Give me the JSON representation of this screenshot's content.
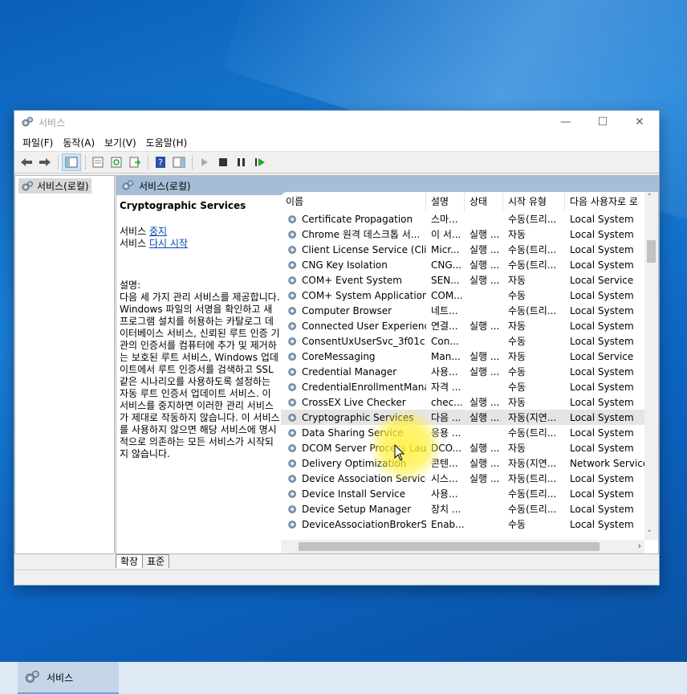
{
  "window": {
    "title": "서비스",
    "controls": [
      "minimize-icon",
      "maximize-icon",
      "close-icon"
    ]
  },
  "menu": [
    "파일(F)",
    "동작(A)",
    "보기(V)",
    "도움말(H)"
  ],
  "tree": {
    "root_label": "서비스(로컬)"
  },
  "pane": {
    "header_label": "서비스(로컬)"
  },
  "detail": {
    "service_name": "Cryptographic Services",
    "stop_prefix": "서비스 ",
    "stop_link": "중지",
    "restart_prefix": "서비스 ",
    "restart_link": "다시 시작",
    "desc_label": "설명:",
    "desc_text": "다음 세 가지 관리 서비스를 제공합니다. Windows 파일의 서명을 확인하고 새 프로그램 설치를 허용하는 카탈로그 데이터베이스 서비스, 신뢰된 루트 인증 기관의 인증서를 컴퓨터에 추가 및 제거하는 보호된 루트 서비스, Windows 업데이트에서 루트 인증서를 검색하고 SSL 같은 시나리오를 사용하도록 설정하는 자동 루트 인증서 업데이트 서비스. 이 서비스를 중지하면 이러한 관리 서비스가 제대로 작동하지 않습니다. 이 서비스를 사용하지 않으면 해당 서비스에 명시적으로 의존하는 모든 서비스가 시작되지 않습니다."
  },
  "columns": [
    "이름",
    "설명",
    "상태",
    "시작 유형",
    "다음 사용자로 로"
  ],
  "services": [
    {
      "name": "Certificate Propagation",
      "desc": "스마...",
      "status": "",
      "startup": "수동(트리...",
      "logon": "Local System"
    },
    {
      "name": "Chrome 원격 데스크톱 서...",
      "desc": "이 서...",
      "status": "실행 ...",
      "startup": "자동",
      "logon": "Local System"
    },
    {
      "name": "Client License Service (Clip...",
      "desc": "Micr...",
      "status": "실행 ...",
      "startup": "수동(트리...",
      "logon": "Local System"
    },
    {
      "name": "CNG Key Isolation",
      "desc": "CNG...",
      "status": "실행 ...",
      "startup": "수동(트리...",
      "logon": "Local System"
    },
    {
      "name": "COM+ Event System",
      "desc": "SEN...",
      "status": "실행 ...",
      "startup": "자동",
      "logon": "Local Service"
    },
    {
      "name": "COM+ System Application",
      "desc": "COM...",
      "status": "",
      "startup": "수동",
      "logon": "Local System"
    },
    {
      "name": "Computer Browser",
      "desc": "네트...",
      "status": "",
      "startup": "수동(트리...",
      "logon": "Local System"
    },
    {
      "name": "Connected User Experience...",
      "desc": "연결...",
      "status": "실행 ...",
      "startup": "자동",
      "logon": "Local System"
    },
    {
      "name": "ConsentUxUserSvc_3f01c",
      "desc": "Con...",
      "status": "",
      "startup": "수동",
      "logon": "Local System"
    },
    {
      "name": "CoreMessaging",
      "desc": "Man...",
      "status": "실행 ...",
      "startup": "자동",
      "logon": "Local Service"
    },
    {
      "name": "Credential Manager",
      "desc": "사용...",
      "status": "실행 ...",
      "startup": "수동",
      "logon": "Local System"
    },
    {
      "name": "CredentialEnrollmentMana...",
      "desc": "자격 ...",
      "status": "",
      "startup": "수동",
      "logon": "Local System"
    },
    {
      "name": "CrossEX Live Checker",
      "desc": "chec...",
      "status": "실행 ...",
      "startup": "자동",
      "logon": "Local System"
    },
    {
      "name": "Cryptographic Services",
      "desc": "다음 ...",
      "status": "실행 ...",
      "startup": "자동(지연...",
      "logon": "Local System"
    },
    {
      "name": "Data Sharing Service",
      "desc": "응용 ...",
      "status": "",
      "startup": "수동(트리...",
      "logon": "Local System"
    },
    {
      "name": "DCOM Server Process Lau...",
      "desc": "DCO...",
      "status": "실행 ...",
      "startup": "자동",
      "logon": "Local System"
    },
    {
      "name": "Delivery Optimization",
      "desc": "콘텐...",
      "status": "실행 ...",
      "startup": "자동(지연...",
      "logon": "Network Service"
    },
    {
      "name": "Device Association Service",
      "desc": "시스...",
      "status": "실행 ...",
      "startup": "자동(트리...",
      "logon": "Local System"
    },
    {
      "name": "Device Install Service",
      "desc": "사용...",
      "status": "",
      "startup": "수동(트리...",
      "logon": "Local System"
    },
    {
      "name": "Device Setup Manager",
      "desc": "장치 ...",
      "status": "",
      "startup": "수동(트리...",
      "logon": "Local System"
    },
    {
      "name": "DeviceAssociationBrokerSv...",
      "desc": "Enab...",
      "status": "",
      "startup": "수동",
      "logon": "Local System"
    }
  ],
  "selected_index": 13,
  "tabs": [
    "확장",
    "표준"
  ],
  "taskbar": {
    "app_label": "서비스"
  },
  "colors": {
    "pane_header": "#a5bdd6",
    "selection": "#e5e5e5",
    "link": "#0645ad",
    "desktop": "#1a7fd6"
  }
}
